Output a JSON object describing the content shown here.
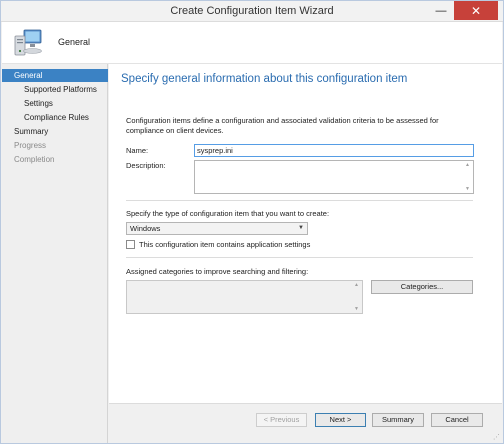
{
  "window": {
    "title": "Create Configuration Item Wizard",
    "minimize_glyph": "—",
    "close_glyph": "✕"
  },
  "header": {
    "title": "General",
    "icon": "computer-icon"
  },
  "sidebar": {
    "items": [
      {
        "label": "General",
        "state": "active"
      },
      {
        "label": "Supported Platforms",
        "state": "normal"
      },
      {
        "label": "Settings",
        "state": "normal"
      },
      {
        "label": "Compliance Rules",
        "state": "normal"
      },
      {
        "label": "Summary",
        "state": "normal"
      },
      {
        "label": "Progress",
        "state": "disabled"
      },
      {
        "label": "Completion",
        "state": "disabled"
      }
    ]
  },
  "main": {
    "heading": "Specify general information about this configuration item",
    "intro": "Configuration items define a configuration and associated validation criteria to be assessed for compliance on client devices.",
    "name_label": "Name:",
    "name_value": "sysprep.ini",
    "description_label": "Description:",
    "description_value": "",
    "type_label": "Specify the type of configuration item that you want to create:",
    "type_selected": "Windows",
    "app_settings_label": "This configuration item contains application settings",
    "app_settings_checked": false,
    "categories_label": "Assigned categories to improve searching and filtering:",
    "categories_button": "Categories..."
  },
  "footer": {
    "previous": "< Previous",
    "next": "Next >",
    "summary": "Summary",
    "cancel": "Cancel"
  },
  "colors": {
    "accent": "#3b82c4",
    "heading": "#2a6cb0",
    "close_button": "#c7413a"
  }
}
